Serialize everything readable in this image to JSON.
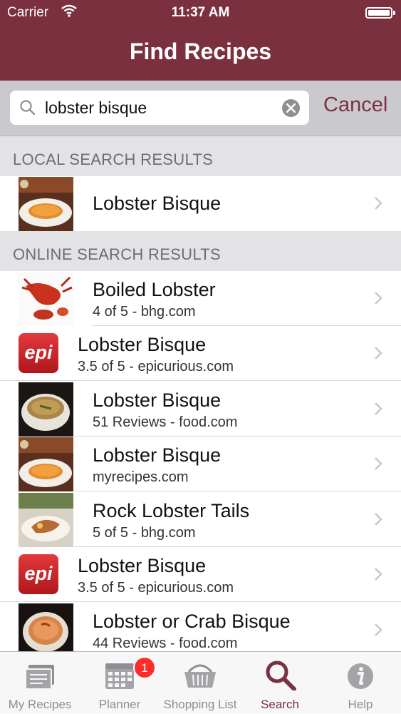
{
  "status_bar": {
    "carrier": "Carrier",
    "time": "11:37 AM"
  },
  "header": {
    "title": "Find Recipes"
  },
  "search": {
    "value": "lobster bisque",
    "cancel_label": "Cancel"
  },
  "sections": {
    "local": {
      "title": "LOCAL SEARCH RESULTS",
      "items": [
        {
          "title": "Lobster Bisque",
          "subtitle": ""
        }
      ]
    },
    "online": {
      "title": "ONLINE SEARCH RESULTS",
      "items": [
        {
          "title": "Boiled Lobster",
          "subtitle": "4 of 5 - bhg.com"
        },
        {
          "title": "Lobster Bisque",
          "subtitle": "3.5 of 5 - epicurious.com",
          "logo": "epi"
        },
        {
          "title": "Lobster Bisque",
          "subtitle": "51 Reviews - food.com"
        },
        {
          "title": "Lobster Bisque",
          "subtitle": "myrecipes.com"
        },
        {
          "title": "Rock Lobster Tails",
          "subtitle": "5 of 5 - bhg.com"
        },
        {
          "title": "Lobster Bisque",
          "subtitle": "3.5 of 5 - epicurious.com",
          "logo": "epi"
        },
        {
          "title": "Lobster or Crab Bisque",
          "subtitle": "44 Reviews - food.com"
        }
      ]
    }
  },
  "tabs": [
    {
      "label": "My Recipes",
      "icon": "recipe-cards-icon"
    },
    {
      "label": "Planner",
      "icon": "calendar-icon",
      "badge": "1"
    },
    {
      "label": "Shopping List",
      "icon": "basket-icon"
    },
    {
      "label": "Search",
      "icon": "magnifier-icon",
      "active": true
    },
    {
      "label": "Help",
      "icon": "info-icon"
    }
  ],
  "colors": {
    "accent": "#7b3040",
    "badge": "#ff2d2a"
  }
}
